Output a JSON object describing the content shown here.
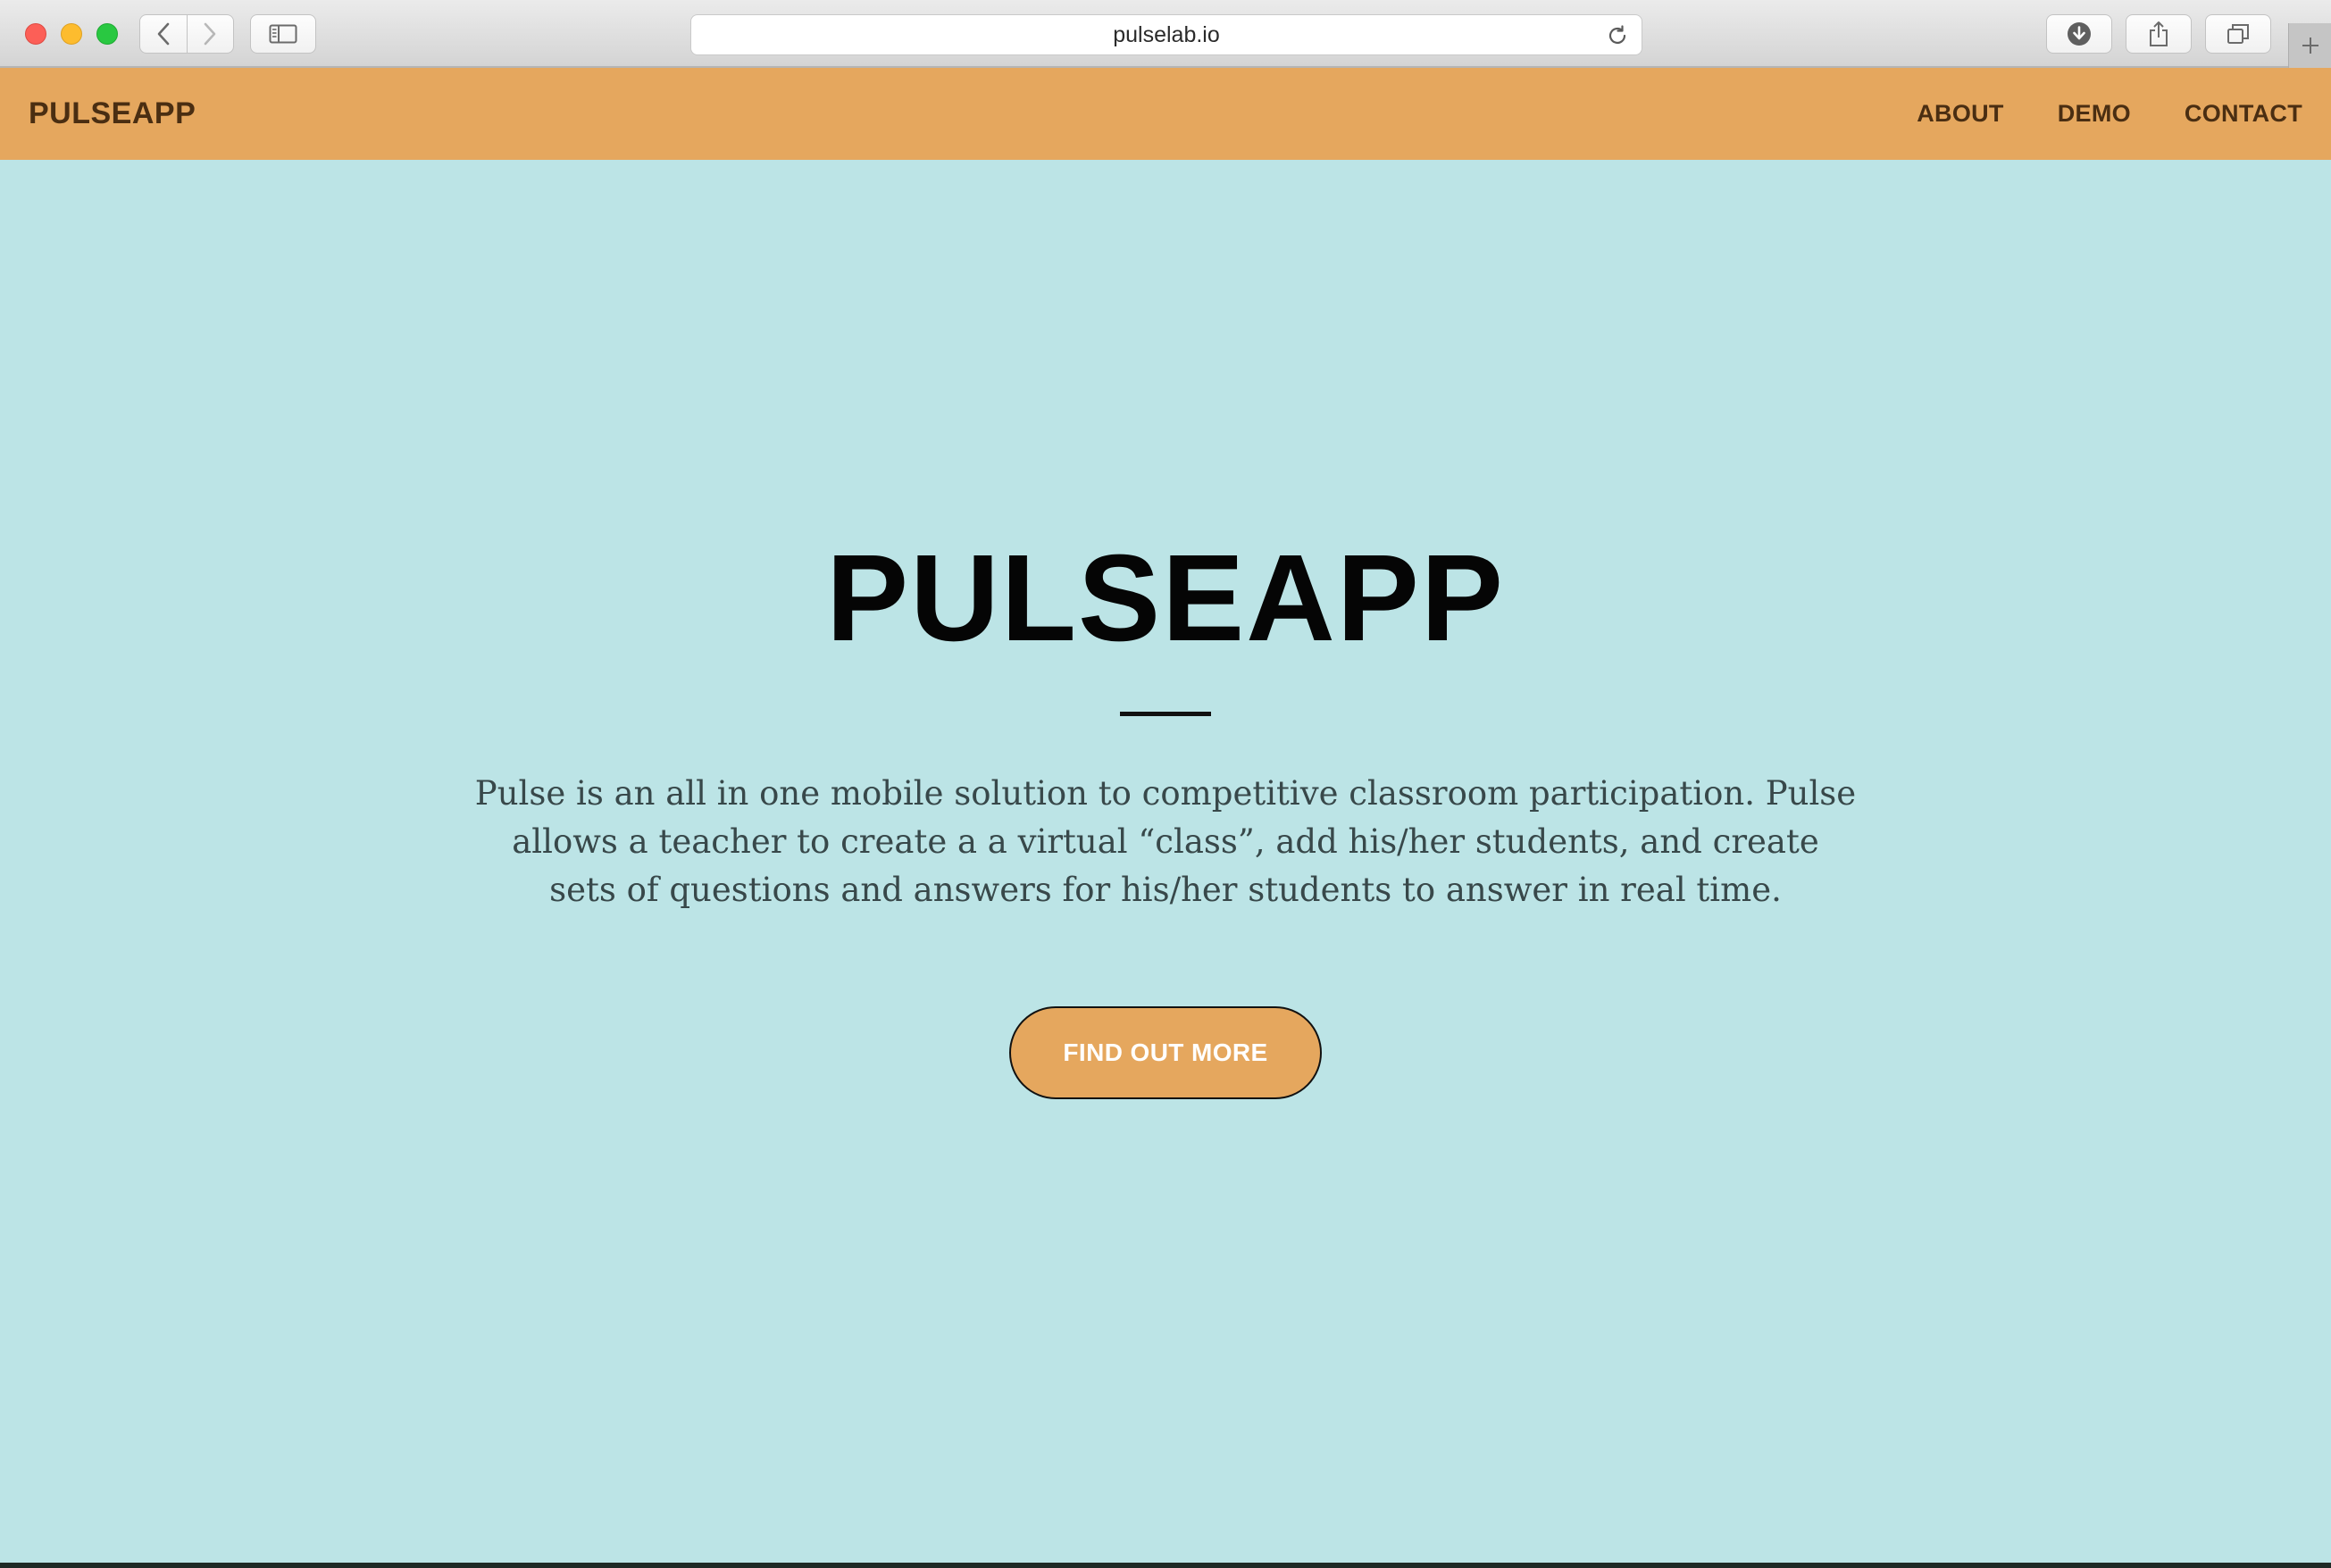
{
  "browser": {
    "url": "pulselab.io",
    "icons": {
      "back": "chevron-left-icon",
      "forward": "chevron-right-icon",
      "sidebar": "sidebar-icon",
      "reload": "reload-icon",
      "download": "download-icon",
      "share": "share-icon",
      "tabs": "tabs-overview-icon",
      "new_tab": "plus-icon"
    }
  },
  "site": {
    "brand": "PULSEAPP",
    "nav": {
      "about": "ABOUT",
      "demo": "DEMO",
      "contact": "CONTACT"
    },
    "hero": {
      "title": "PULSEAPP",
      "description": "Pulse is an all in one mobile solution to competitive classroom participation. Pulse allows a teacher to create a a virtual “class”, add his/her students, and create sets of questions and answers for his/her students to answer in real time.",
      "cta_label": "FIND OUT MORE"
    }
  },
  "colors": {
    "nav_background": "#e5a75e",
    "hero_background": "#bce4e6",
    "nav_text": "#4a2e12",
    "cta_background": "#e5a75e",
    "cta_text": "#ffffff"
  }
}
